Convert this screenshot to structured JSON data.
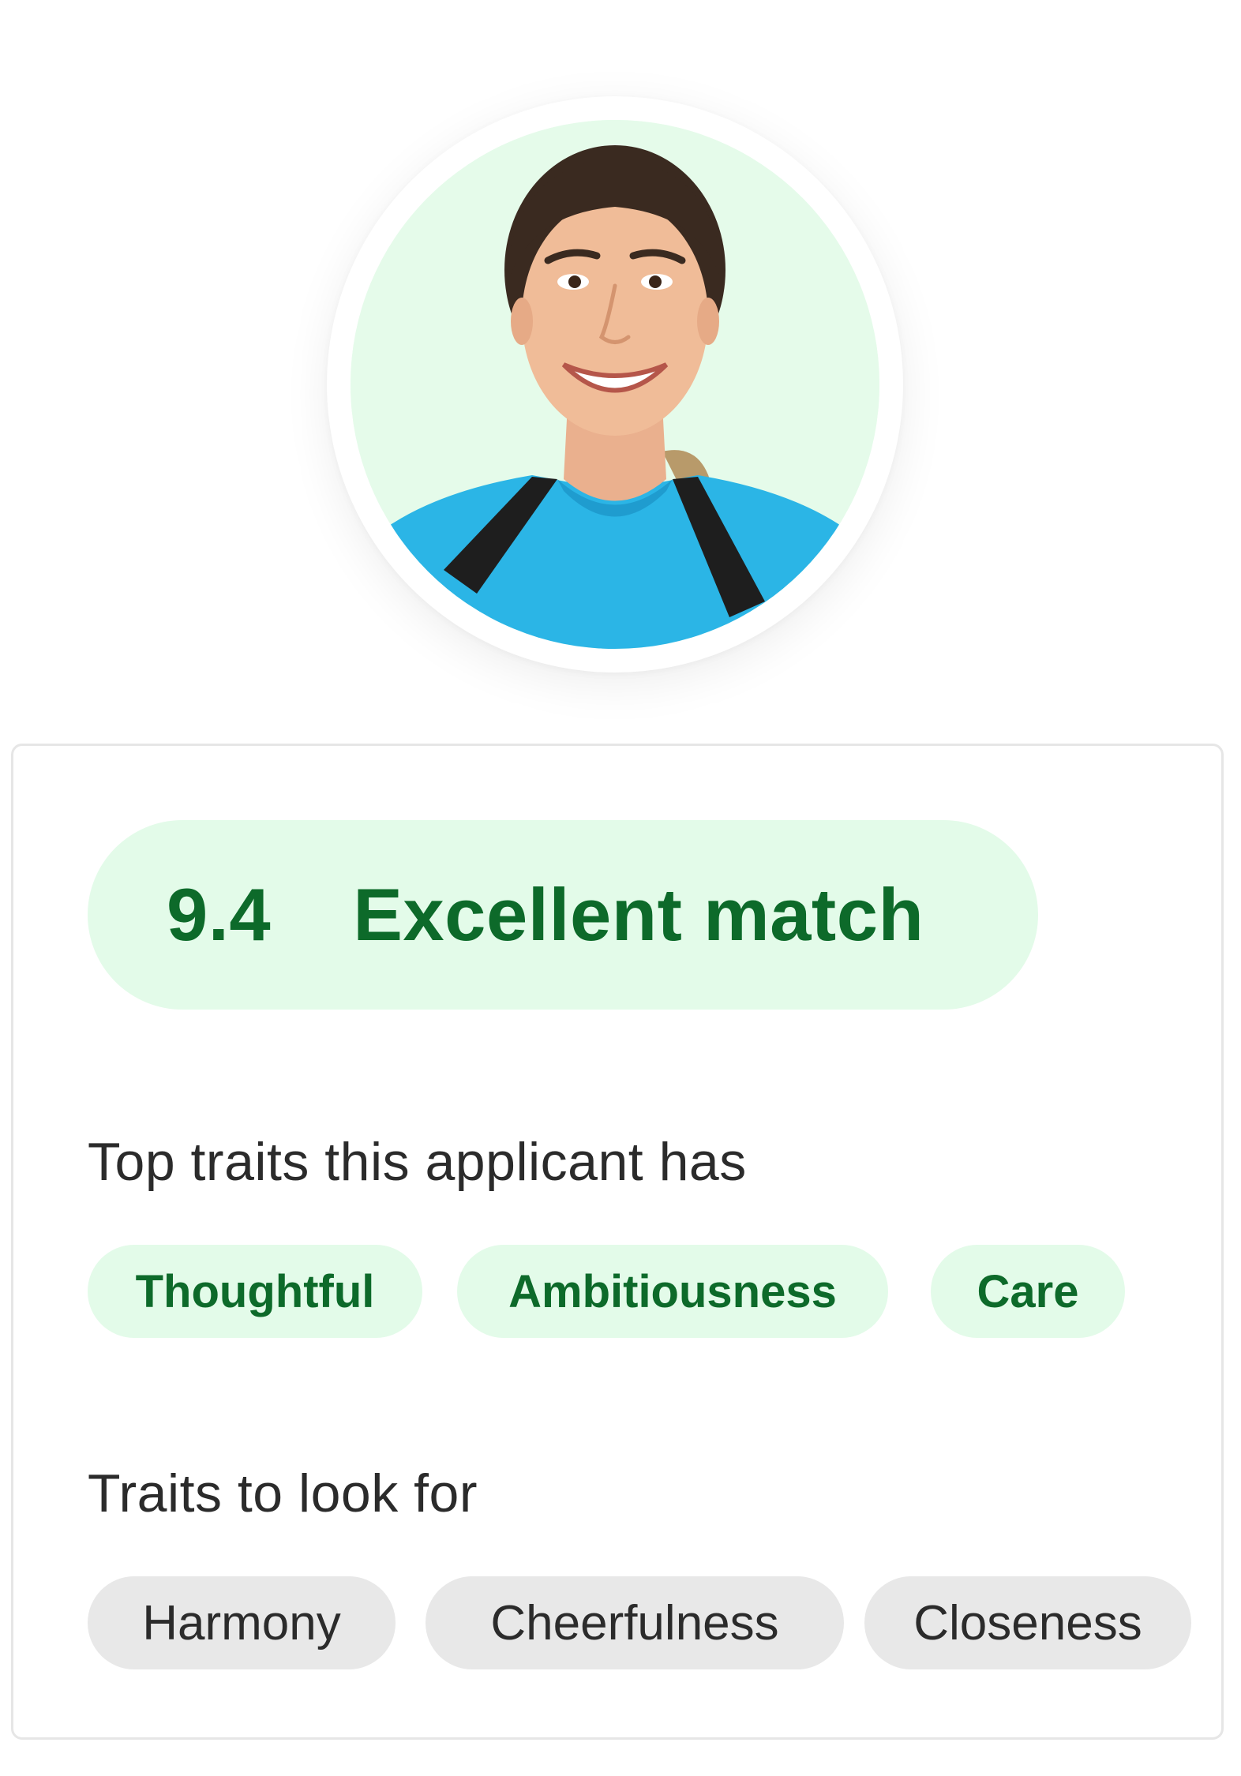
{
  "applicant": {
    "photo_label": "applicant photo",
    "avatar_bg": "#e5fbea"
  },
  "match": {
    "score": "9.4",
    "label": "Excellent match",
    "color": "#0d6a2a",
    "pill_bg": "#e3fbe9"
  },
  "top_traits": {
    "heading": "Top traits this applicant has",
    "items": [
      "Thoughtful",
      "Ambitiousness",
      "Care"
    ]
  },
  "look_for_traits": {
    "heading": "Traits to look for",
    "items": [
      "Harmony",
      "Cheerfulness",
      "Closeness"
    ]
  },
  "colors": {
    "text_dark": "#2b2b2b",
    "chip_grey": "#e8e8e8",
    "card_border": "#e6e6e6"
  }
}
